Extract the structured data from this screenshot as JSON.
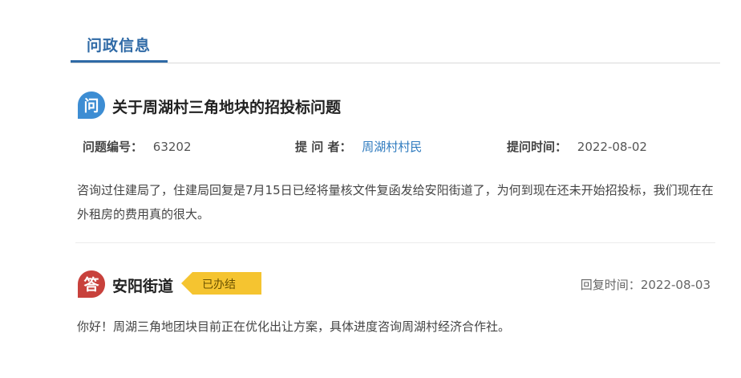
{
  "tab": {
    "label": "问政信息",
    "accent": "#2f6aa6"
  },
  "question": {
    "icon_char": "问",
    "icon_color": "#3d8dd3",
    "title": "关于周湖村三角地块的招投标问题",
    "number_label": "问题编号：",
    "number_value": "63202",
    "asker_label": "提 问 者：",
    "asker_value": "周湖村村民",
    "time_label": "提问时间：",
    "time_value": "2022-08-02",
    "body": "咨询过住建局了，住建局回复是7月15日已经将量核文件复函发给安阳街道了，为何到现在还未开始招投标，我们现在在外租房的费用真的很大。"
  },
  "answer": {
    "icon_char": "答",
    "icon_color": "#c8413c",
    "department": "安阳街道",
    "status": "已办结",
    "status_color": "#f5c430",
    "time_label": "回复时间：",
    "time_value": "2022-08-03",
    "body": "你好！周湖三角地团块目前正在优化出让方案，具体进度咨询周湖村经济合作社。"
  }
}
